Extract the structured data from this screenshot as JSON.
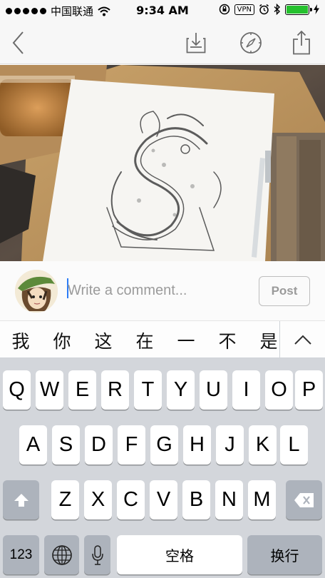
{
  "status_bar": {
    "carrier": "中国联通",
    "time": "9:34 AM",
    "vpn": "VPN"
  },
  "nav": {
    "back_icon": "chevron-left-icon",
    "save_icon": "save-to-tray-icon",
    "compass_icon": "compass-icon",
    "share_icon": "share-icon"
  },
  "comment": {
    "placeholder": "Write a comment...",
    "post_label": "Post"
  },
  "candidates": [
    "我",
    "你",
    "这",
    "在",
    "一",
    "不",
    "是"
  ],
  "keyboard": {
    "row1": [
      "Q",
      "W",
      "E",
      "R",
      "T",
      "Y",
      "U",
      "I",
      "O",
      "P"
    ],
    "row2": [
      "A",
      "S",
      "D",
      "F",
      "G",
      "H",
      "J",
      "K",
      "L"
    ],
    "row3": [
      "Z",
      "X",
      "C",
      "V",
      "B",
      "N",
      "M"
    ],
    "numbers_label": "123",
    "space_label": "空格",
    "return_label": "换行"
  },
  "colors": {
    "accent": "#2c7cf6",
    "battery": "#25c12e",
    "keyboard_bg": "#d3d6db"
  }
}
